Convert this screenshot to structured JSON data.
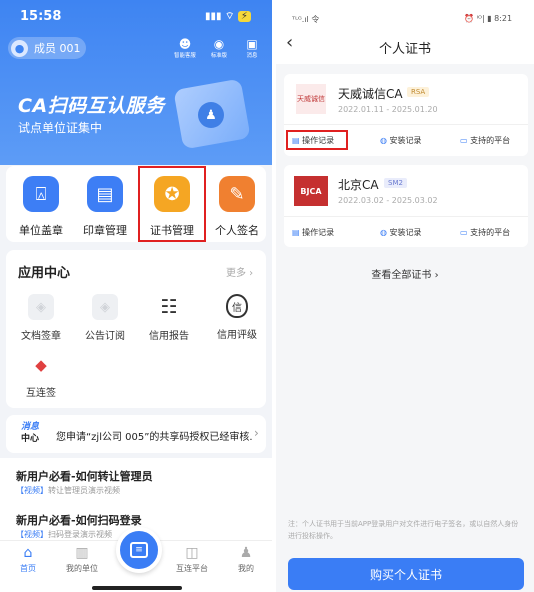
{
  "left": {
    "status": {
      "time": "15:58"
    },
    "member": "成员 001",
    "top_icons": [
      {
        "label": "智能客服",
        "icon": "customer-service-icon"
      },
      {
        "label": "标准版",
        "icon": "badge-icon"
      },
      {
        "label": "消息",
        "icon": "message-icon"
      }
    ],
    "banner": {
      "title": "CA扫码互认服务",
      "subtitle": "试点单位证集中"
    },
    "quick": [
      {
        "label": "单位盖章",
        "color": "#3d7ef5",
        "icon": "stamp-icon"
      },
      {
        "label": "印章管理",
        "color": "#3d7ef5",
        "icon": "seal-manage-icon"
      },
      {
        "label": "证书管理",
        "color": "#f5a623",
        "icon": "certificate-icon"
      },
      {
        "label": "个人签名",
        "color": "#f08030",
        "icon": "sign-pen-icon"
      }
    ],
    "apps": {
      "title": "应用中心",
      "more": "更多",
      "items": [
        {
          "label": "文档签章",
          "icon": "doc-sign-icon"
        },
        {
          "label": "公告订阅",
          "icon": "subscribe-icon"
        },
        {
          "label": "信用报告",
          "icon": "report-icon"
        },
        {
          "label": "信用评级",
          "icon": "rating-icon"
        },
        {
          "label": "互连签",
          "icon": "interconnect-icon"
        }
      ]
    },
    "notice": {
      "badge1": "消息",
      "badge2": "中心",
      "text": "您申请“zjl公司 005”的共享码授权已经审核..."
    },
    "guides": [
      {
        "title": "新用户必看-如何转让管理员",
        "tag": "【视频】",
        "desc": "转让管理员演示视频"
      },
      {
        "title": "新用户必看-如何扫码登录",
        "tag": "【视频】",
        "desc": "扫码登录演示视频"
      }
    ],
    "tabs": [
      {
        "label": "首页"
      },
      {
        "label": "我的单位"
      },
      {
        "label": ""
      },
      {
        "label": "互连平台"
      },
      {
        "label": "我的"
      }
    ]
  },
  "right": {
    "status": {
      "left": "ᵀᴸᴳ.ıl 令",
      "right": "⏰ ᴵᴼ| ▮ 8:21"
    },
    "title": "个人证书",
    "certs": [
      {
        "name": "天威诚信CA",
        "tag": "RSA",
        "date": "2022.01.11 - 2025.01.20",
        "logo": "天威诚信",
        "actions": [
          "操作记录",
          "安装记录",
          "支持的平台"
        ]
      },
      {
        "name": "北京CA",
        "tag": "SM2",
        "date": "2022.03.02 - 2025.03.02",
        "logo": "BJCA",
        "actions": [
          "操作记录",
          "安装记录",
          "支持的平台"
        ]
      }
    ],
    "view_all": "查看全部证书",
    "note": "注：个人证书用于当前APP登录用户对文件进行电子签名，或以自然人身份进行投标操作。",
    "buy": "购买个人证书",
    "colors": {
      "accent": "#3a7df5",
      "highlight": "#e02020"
    }
  }
}
